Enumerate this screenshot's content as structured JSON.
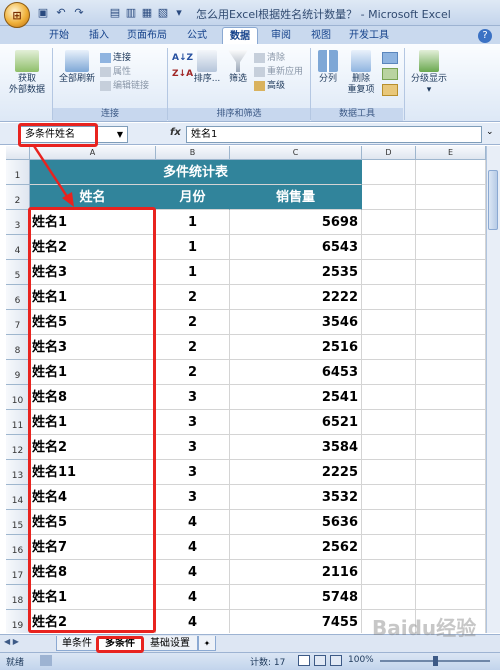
{
  "window": {
    "title": "怎么用Excel根据姓名统计数量？ - Microsoft Excel"
  },
  "tabs": [
    "开始",
    "插入",
    "页面布局",
    "公式",
    "数据",
    "审阅",
    "视图",
    "开发工具"
  ],
  "active_tab": "数据",
  "ribbon": {
    "get_external": [
      "获取",
      "外部数据"
    ],
    "refresh_all": "全部刷新",
    "connections": "连接",
    "properties": "属性",
    "edit_links": "编辑链接",
    "group_connections": "连接",
    "sort_az": "A↓Z",
    "sort": "排序...",
    "filter": "筛选",
    "clear": "清除",
    "reapply": "重新应用",
    "advanced": "高级",
    "group_sort_filter": "排序和筛选",
    "text_to_columns": "分列",
    "remove_duplicates": [
      "删除",
      "重复项"
    ],
    "group_data_tools": "数据工具",
    "outline": "分级显示"
  },
  "formula_bar": {
    "name_box": "多条件姓名",
    "formula": "姓名1",
    "fx": "fx"
  },
  "columns": [
    "A",
    "B",
    "C",
    "D",
    "E"
  ],
  "rows": [
    "1",
    "2",
    "3",
    "4",
    "5",
    "6",
    "7",
    "8",
    "9",
    "10",
    "11",
    "12",
    "13",
    "14",
    "15",
    "16",
    "17",
    "18",
    "19"
  ],
  "table": {
    "title": "多件统计表",
    "headers": [
      "姓名",
      "月份",
      "销售量"
    ],
    "data": [
      [
        "姓名1",
        "1",
        "5698"
      ],
      [
        "姓名2",
        "1",
        "6543"
      ],
      [
        "姓名3",
        "1",
        "2535"
      ],
      [
        "姓名1",
        "2",
        "2222"
      ],
      [
        "姓名5",
        "2",
        "3546"
      ],
      [
        "姓名3",
        "2",
        "2516"
      ],
      [
        "姓名1",
        "2",
        "6453"
      ],
      [
        "姓名8",
        "3",
        "2541"
      ],
      [
        "姓名1",
        "3",
        "6521"
      ],
      [
        "姓名2",
        "3",
        "3584"
      ],
      [
        "姓名11",
        "3",
        "2225"
      ],
      [
        "姓名4",
        "3",
        "3532"
      ],
      [
        "姓名5",
        "4",
        "5636"
      ],
      [
        "姓名7",
        "4",
        "2562"
      ],
      [
        "姓名8",
        "4",
        "2116"
      ],
      [
        "姓名1",
        "4",
        "5748"
      ],
      [
        "姓名2",
        "4",
        "7455"
      ]
    ]
  },
  "sheets": [
    "单条件",
    "多条件",
    "基础设置"
  ],
  "active_sheet": "多条件",
  "status": {
    "ready": "就绪",
    "count": "计数: 17",
    "zoom": "100%"
  },
  "watermark": "Baidu经验"
}
